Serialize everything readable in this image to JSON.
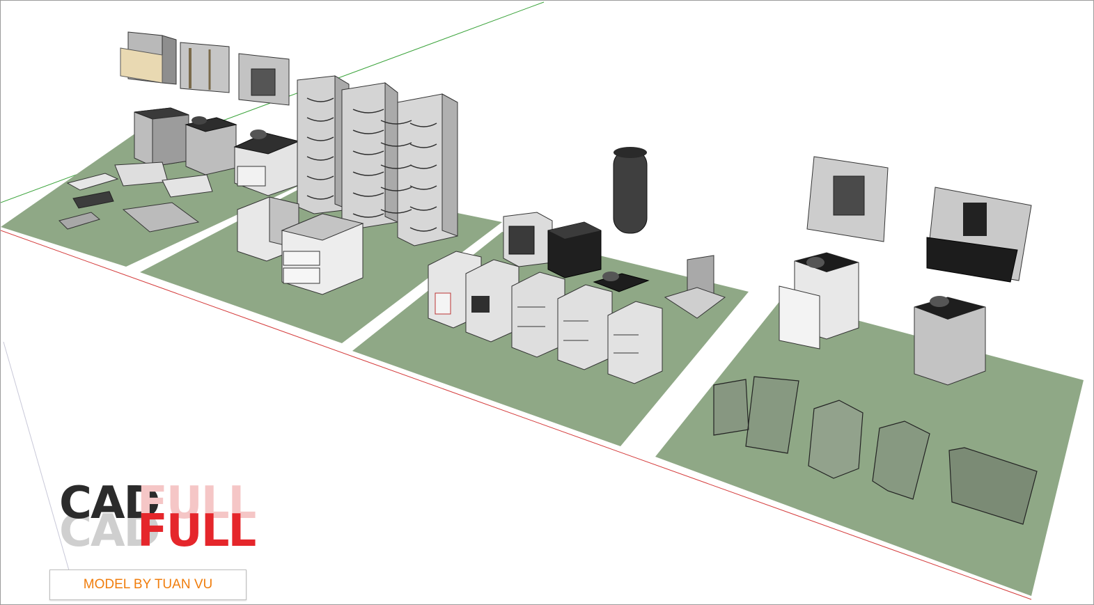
{
  "viewport": {
    "background": "#ffffff",
    "floor_color": "#8fa886",
    "red_axis_color": "#d43a3a",
    "green_axis_color": "#3aa33a"
  },
  "logo": {
    "word_1": "CAD",
    "word_2": "FULL"
  },
  "credit": {
    "text": "MODEL BY TUAN VU"
  }
}
